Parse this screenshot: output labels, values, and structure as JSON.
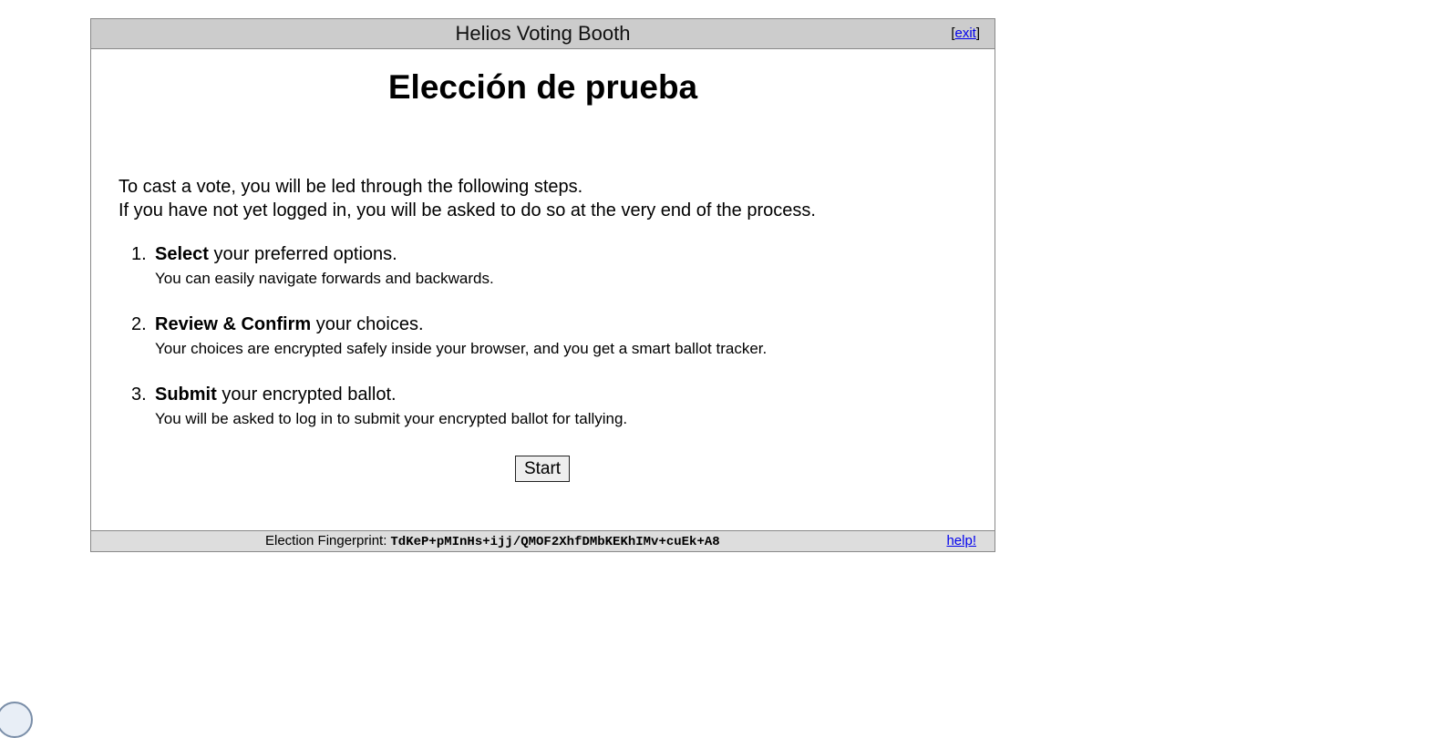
{
  "header": {
    "title": "Helios Voting Booth",
    "exit_open": "[",
    "exit_label": "exit",
    "exit_close": "]"
  },
  "election": {
    "name": "Elección de prueba"
  },
  "intro": {
    "line1": "To cast a vote, you will be led through the following steps.",
    "line2": "If you have not yet logged in, you will be asked to do so at the very end of the process."
  },
  "steps": [
    {
      "number": "1.",
      "bold": "Select",
      "rest": " your preferred options.",
      "detail": "You can easily navigate forwards and backwards."
    },
    {
      "number": "2.",
      "bold": "Review & Confirm",
      "rest": " your choices.",
      "detail": "Your choices are encrypted safely inside your browser, and you get a smart ballot tracker."
    },
    {
      "number": "3.",
      "bold": "Submit",
      "rest": " your encrypted ballot.",
      "detail": "You will be asked to log in to submit your encrypted ballot for tallying."
    }
  ],
  "start_button": {
    "label": "Start"
  },
  "footer": {
    "fingerprint_label": "Election Fingerprint:",
    "fingerprint_value": "TdKeP+pMInHs+ijj/QMOF2XhfDMbKEKhIMv+cuEk+A8",
    "help_label": "help!"
  },
  "corner_icon": {
    "icon": "circle-avatar-icon"
  }
}
